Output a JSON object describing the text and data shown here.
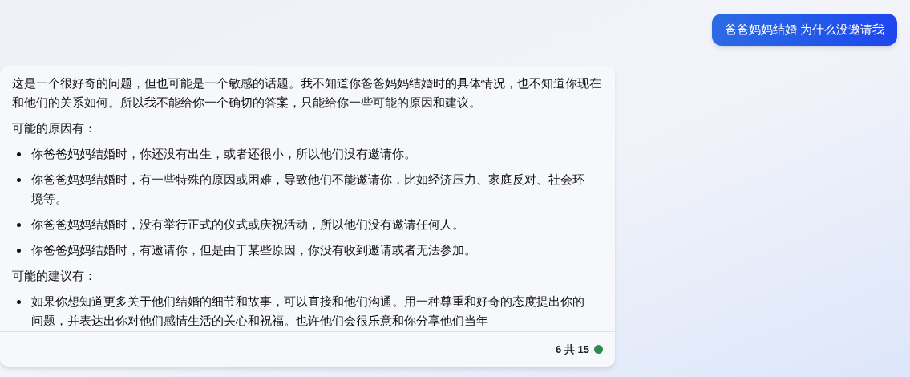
{
  "user_message": "爸爸妈妈结婚 为什么没邀请我",
  "reply": {
    "blocks": [
      {
        "kind": "paragraph",
        "text": "这是一个很好奇的问题，但也可能是一个敏感的话题。我不知道你爸爸妈妈结婚时的具体情况，也不知道你现在和他们的关系如何。所以我不能给你一个确切的答案，只能给你一些可能的原因和建议。"
      },
      {
        "kind": "paragraph",
        "text": "可能的原因有："
      },
      {
        "kind": "bullet",
        "text": "你爸爸妈妈结婚时，你还没有出生，或者还很小，所以他们没有邀请你。"
      },
      {
        "kind": "bullet",
        "text": "你爸爸妈妈结婚时，有一些特殊的原因或困难，导致他们不能邀请你，比如经济压力、家庭反对、社会环境等。"
      },
      {
        "kind": "bullet",
        "text": "你爸爸妈妈结婚时，没有举行正式的仪式或庆祝活动，所以他们没有邀请任何人。"
      },
      {
        "kind": "bullet",
        "text": "你爸爸妈妈结婚时，有邀请你，但是由于某些原因，你没有收到邀请或者无法参加。"
      },
      {
        "kind": "paragraph",
        "text": "可能的建议有："
      },
      {
        "kind": "bullet",
        "text": "如果你想知道更多关于他们结婚的细节和故事，可以直接和他们沟通。用一种尊重和好奇的态度提出你的问题，并表达出你对他们感情生活的关心和祝福。也许他们会很乐意和你分享他们当年"
      }
    ],
    "counter": "6 共 15"
  }
}
